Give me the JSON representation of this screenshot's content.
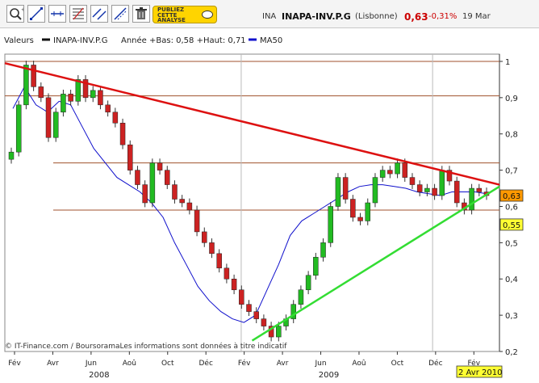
{
  "toolbar": {
    "tools": [
      {
        "name": "zoom-tool-icon"
      },
      {
        "name": "draw-line-icon"
      },
      {
        "name": "horizontal-line-icon"
      },
      {
        "name": "fibonacci-icon"
      },
      {
        "name": "parallel-lines-icon"
      },
      {
        "name": "trend-channel-icon"
      },
      {
        "name": "trash-icon"
      }
    ],
    "publish_label": "PUBLIEZ\nCETTE\nANALYSE"
  },
  "quote": {
    "code": "INA",
    "name": "INAPA-INV.P.G",
    "market": "(Lisbonne)",
    "price": "0,63",
    "change": "-0,31%",
    "date": "19 Mar",
    "price_color": "#cc0000",
    "change_color": "#cc0000"
  },
  "legend": {
    "title": "Valeurs",
    "series_label": "INAPA-INV.P.G",
    "range_text": "Année +Bas: 0,58 +Haut: 0,71",
    "ma_label": "MA50",
    "ma_color": "#1010cc"
  },
  "footer": {
    "source": "© IT-Finance.com / BoursoramaLes informations sont données à titre indicatif",
    "date_badge": "2 Avr 2010"
  },
  "chart_data": {
    "type": "candlestick",
    "y_ticks": [
      "1",
      "0,9",
      "0,8",
      "0,7",
      "0,6",
      "0,5",
      "0,4",
      "0,3",
      "0,2"
    ],
    "ylim": [
      0.2,
      1.02
    ],
    "x_ticks": [
      "Fév",
      "Avr",
      "Jun",
      "Aoû",
      "Oct",
      "Déc",
      "Fév",
      "Avr",
      "Jun",
      "Aoû",
      "Oct",
      "Déc",
      "Fév"
    ],
    "years": [
      "2008",
      "2009"
    ],
    "price_badges": [
      {
        "label": "0,63",
        "value": 0.63,
        "color": "#ff9900"
      },
      {
        "label": "0,55",
        "value": 0.55,
        "color": "#ffff33"
      }
    ],
    "horizontal_levels": [
      1.0,
      0.905,
      0.72,
      0.59
    ],
    "close_series": [
      0.75,
      0.88,
      0.99,
      0.93,
      0.9,
      0.79,
      0.86,
      0.91,
      0.89,
      0.95,
      0.9,
      0.92,
      0.88,
      0.86,
      0.83,
      0.77,
      0.7,
      0.66,
      0.61,
      0.72,
      0.7,
      0.66,
      0.62,
      0.61,
      0.59,
      0.53,
      0.5,
      0.47,
      0.43,
      0.4,
      0.37,
      0.33,
      0.31,
      0.29,
      0.27,
      0.24,
      0.27,
      0.29,
      0.33,
      0.37,
      0.41,
      0.46,
      0.5,
      0.6,
      0.68,
      0.62,
      0.57,
      0.56,
      0.61,
      0.68,
      0.7,
      0.69,
      0.72,
      0.68,
      0.66,
      0.64,
      0.65,
      0.63,
      0.7,
      0.67,
      0.61,
      0.59,
      0.65,
      0.64,
      0.63
    ],
    "ma50_series": [
      0.87,
      0.93,
      0.88,
      0.86,
      0.89,
      0.88,
      0.82,
      0.76,
      0.72,
      0.68,
      0.66,
      0.64,
      0.61,
      0.57,
      0.5,
      0.44,
      0.38,
      0.34,
      0.31,
      0.29,
      0.28,
      0.3,
      0.37,
      0.44,
      0.52,
      0.56,
      0.58,
      0.6,
      0.62,
      0.64,
      0.655,
      0.66,
      0.66,
      0.655,
      0.65,
      0.64,
      0.635,
      0.63,
      0.64,
      0.64,
      0.64,
      0.635
    ],
    "trend_lines": [
      {
        "name": "resistance",
        "color": "#dd1111",
        "from": [
          0,
          0.995
        ],
        "to": [
          1,
          0.66
        ]
      },
      {
        "name": "support",
        "color": "#33dd33",
        "from": [
          0.5,
          0.23
        ],
        "to": [
          1,
          0.655
        ]
      }
    ]
  }
}
